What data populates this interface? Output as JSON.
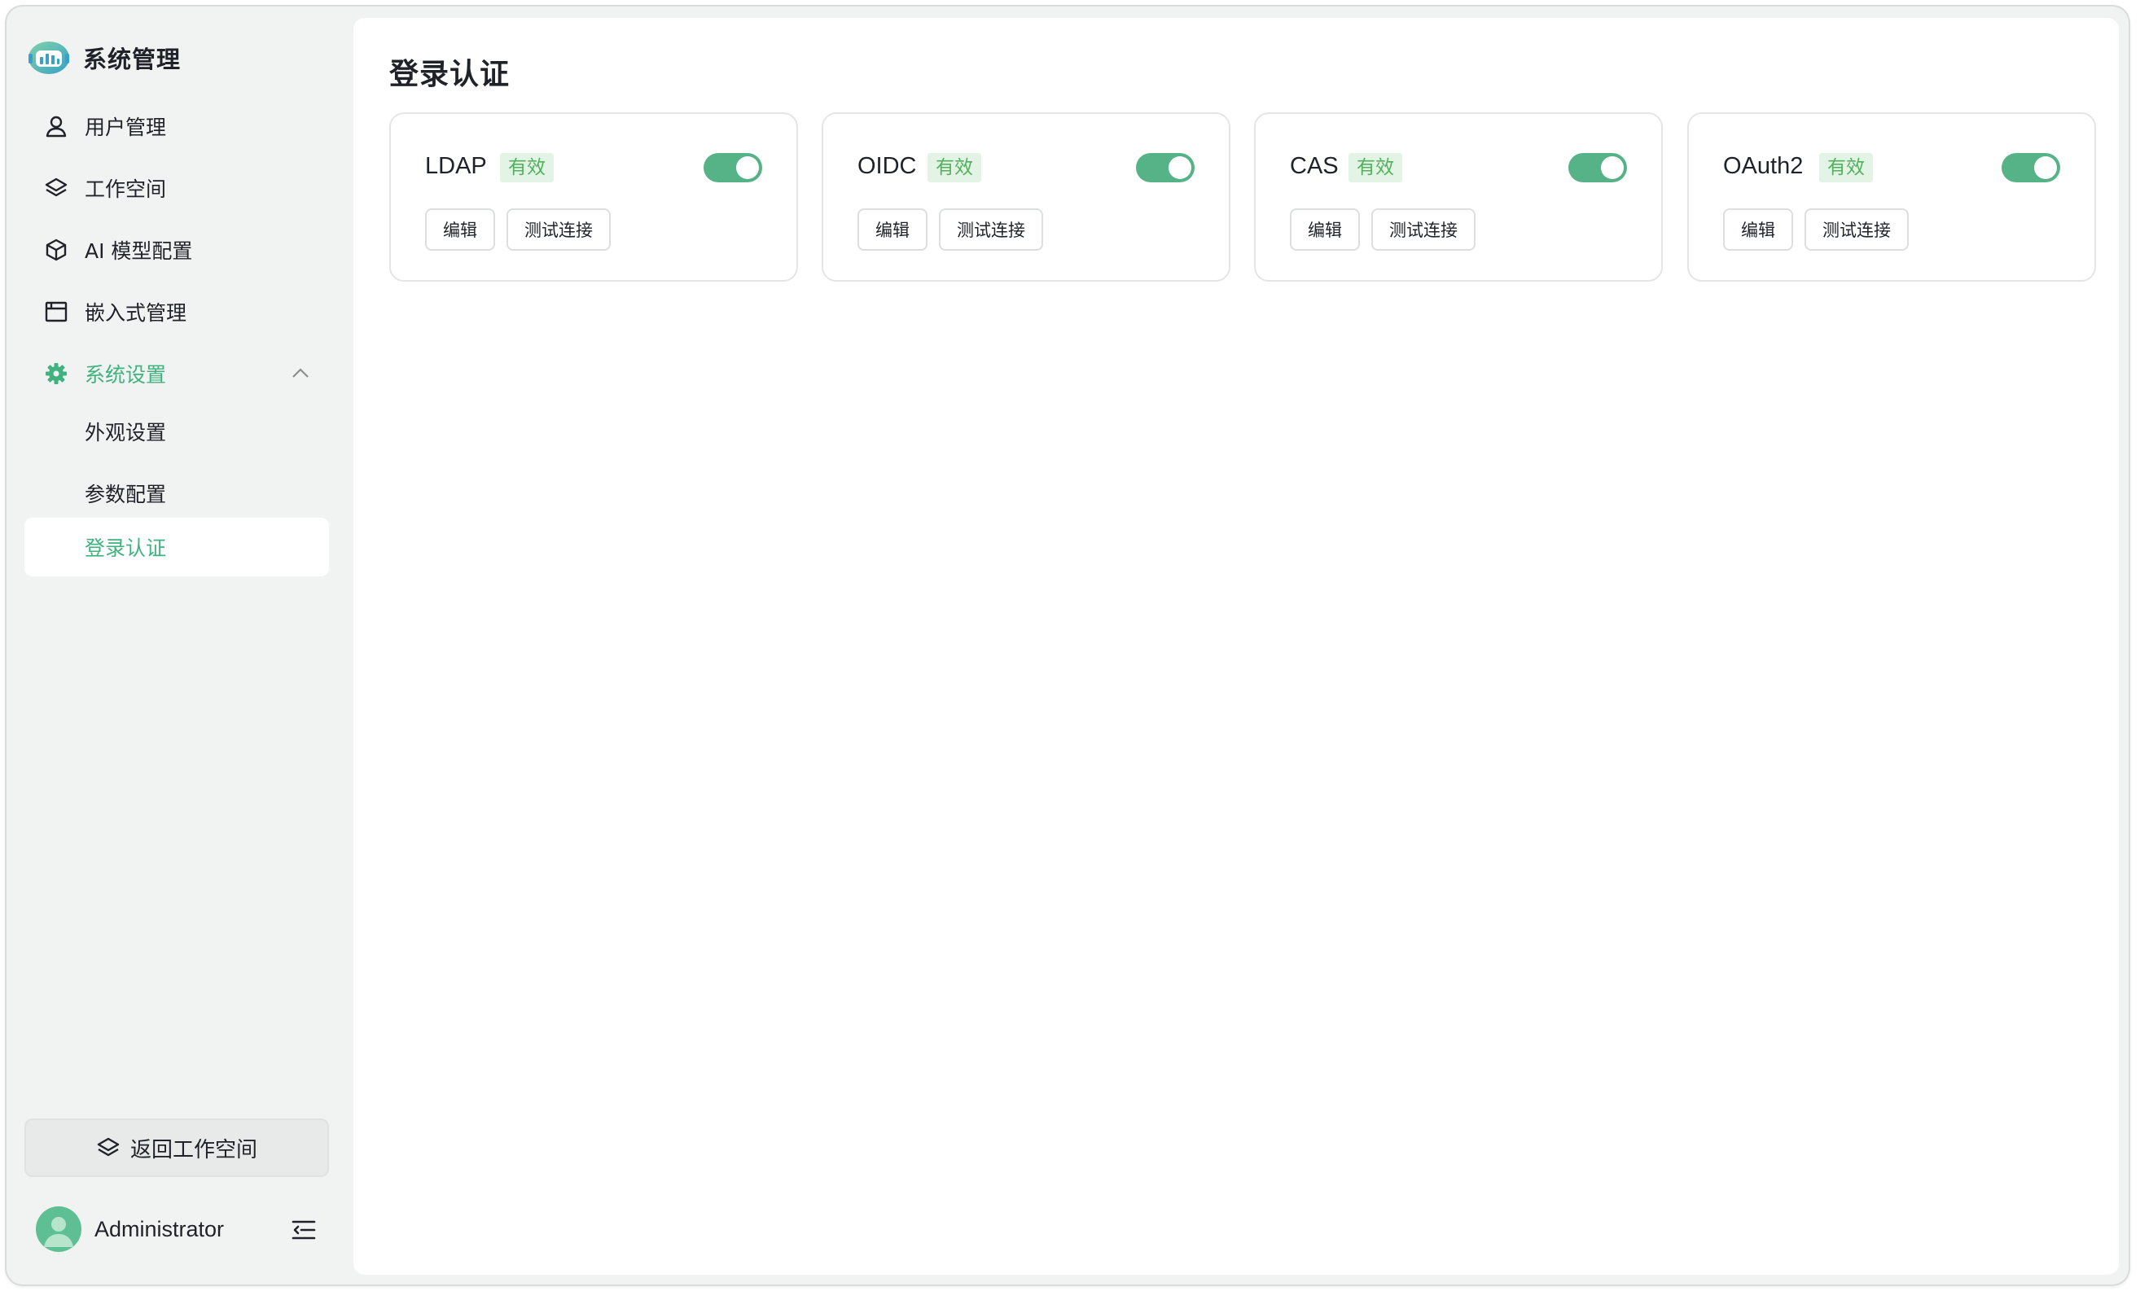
{
  "sidebar": {
    "title": "系统管理",
    "nav": [
      {
        "label": "用户管理",
        "icon": "user-icon"
      },
      {
        "label": "工作空间",
        "icon": "layers-icon"
      },
      {
        "label": "AI 模型配置",
        "icon": "cube-icon"
      },
      {
        "label": "嵌入式管理",
        "icon": "window-icon"
      },
      {
        "label": "系统设置",
        "icon": "gear-icon"
      }
    ],
    "sub_items": [
      {
        "label": "外观设置"
      },
      {
        "label": "参数配置"
      },
      {
        "label": "登录认证"
      }
    ],
    "back_button": "返回工作空间",
    "user_name": "Administrator"
  },
  "main": {
    "title": "登录认证",
    "cards": [
      {
        "name": "LDAP",
        "status": "有效",
        "enabled": true,
        "edit": "编辑",
        "test": "测试连接"
      },
      {
        "name": "OIDC",
        "status": "有效",
        "enabled": true,
        "edit": "编辑",
        "test": "测试连接"
      },
      {
        "name": "CAS",
        "status": "有效",
        "enabled": true,
        "edit": "编辑",
        "test": "测试连接"
      },
      {
        "name": "OAuth2",
        "status": "有效",
        "enabled": true,
        "edit": "编辑",
        "test": "测试连接"
      }
    ]
  },
  "colors": {
    "accent": "#3fb27f",
    "toggle_on": "#56b387",
    "badge_bg": "#e3f4e6",
    "badge_text": "#52b25c",
    "sidebar_bg": "#f1f3f2"
  }
}
